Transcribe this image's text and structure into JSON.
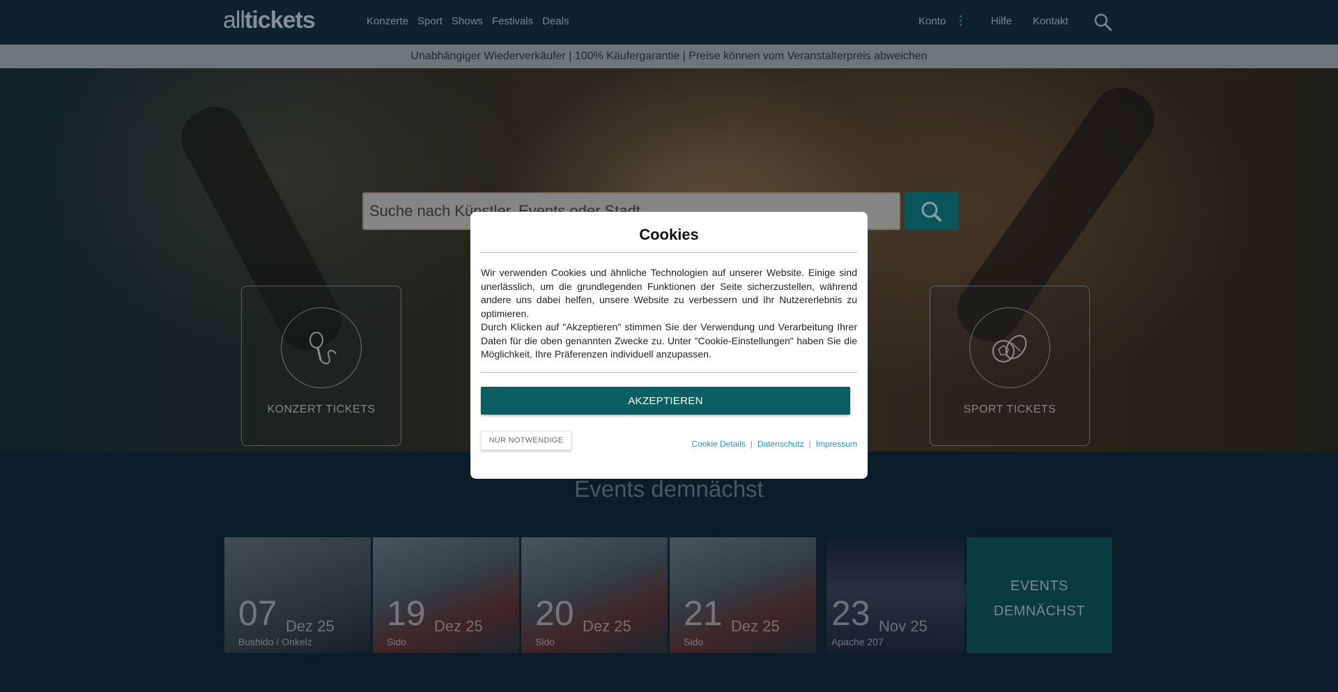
{
  "header": {
    "logo_all": "all",
    "logo_tickets": "tickets",
    "nav": [
      "Konzerte",
      "Sport",
      "Shows",
      "Festivals",
      "Deals"
    ],
    "account": "Konto",
    "help": "Hilfe",
    "contact": "Kontakt"
  },
  "banner": "Unabhängiger Wiederverkäufer | 100% Käufergarantie | Preise können vom Veranstalterpreis abweichen",
  "hero": {
    "search_placeholder": "Suche nach Künstler, Events oder Stadt",
    "categories": [
      {
        "label": "KONZERT TICKETS",
        "icon": "microphone-icon"
      },
      {
        "label": "SPORT TICKETS",
        "icon": "sports-balls-icon"
      }
    ]
  },
  "events": {
    "title": "Events demnächst",
    "items": [
      {
        "day": "07",
        "month": "Dez 25",
        "artist": "Bushido / Onkelz"
      },
      {
        "day": "19",
        "month": "Dez 25",
        "artist": "Sido"
      },
      {
        "day": "20",
        "month": "Dez 25",
        "artist": "Sido"
      },
      {
        "day": "21",
        "month": "Dez 25",
        "artist": "Sido"
      },
      {
        "day": "23",
        "month": "Nov 25",
        "artist": "Apache 207"
      }
    ],
    "more_line1": "EVENTS",
    "more_line2": "DEMNÄCHST"
  },
  "cookie_modal": {
    "title": "Cookies",
    "paragraph1": "Wir verwenden Cookies und ähnliche Technologien auf unserer Website. Einige sind unerlässlich, um die grundlegenden Funktionen der Seite sicherzustellen, während andere uns dabei helfen, unsere Website zu verbessern und Ihr Nutzererlebnis zu optimieren.",
    "paragraph2": "Durch Klicken auf \"Akzeptieren\" stimmen Sie der Verwendung und Verarbeitung Ihrer Daten für die oben genannten Zwecke zu. Unter \"Cookie-Einstellungen\" haben Sie die Möglichkeit, Ihre Präferenzen individuell anzupassen.",
    "accept": "AKZEPTIEREN",
    "necessary": "NUR NOTWENDIGE",
    "link_details": "Cookie Details",
    "link_privacy": "Datenschutz",
    "link_imprint": "Impressum"
  },
  "colors": {
    "header_bg": "#11283a",
    "accent_teal": "#0b5f63",
    "link_blue": "#1796c6",
    "banner_bg": "#a3abaf"
  }
}
